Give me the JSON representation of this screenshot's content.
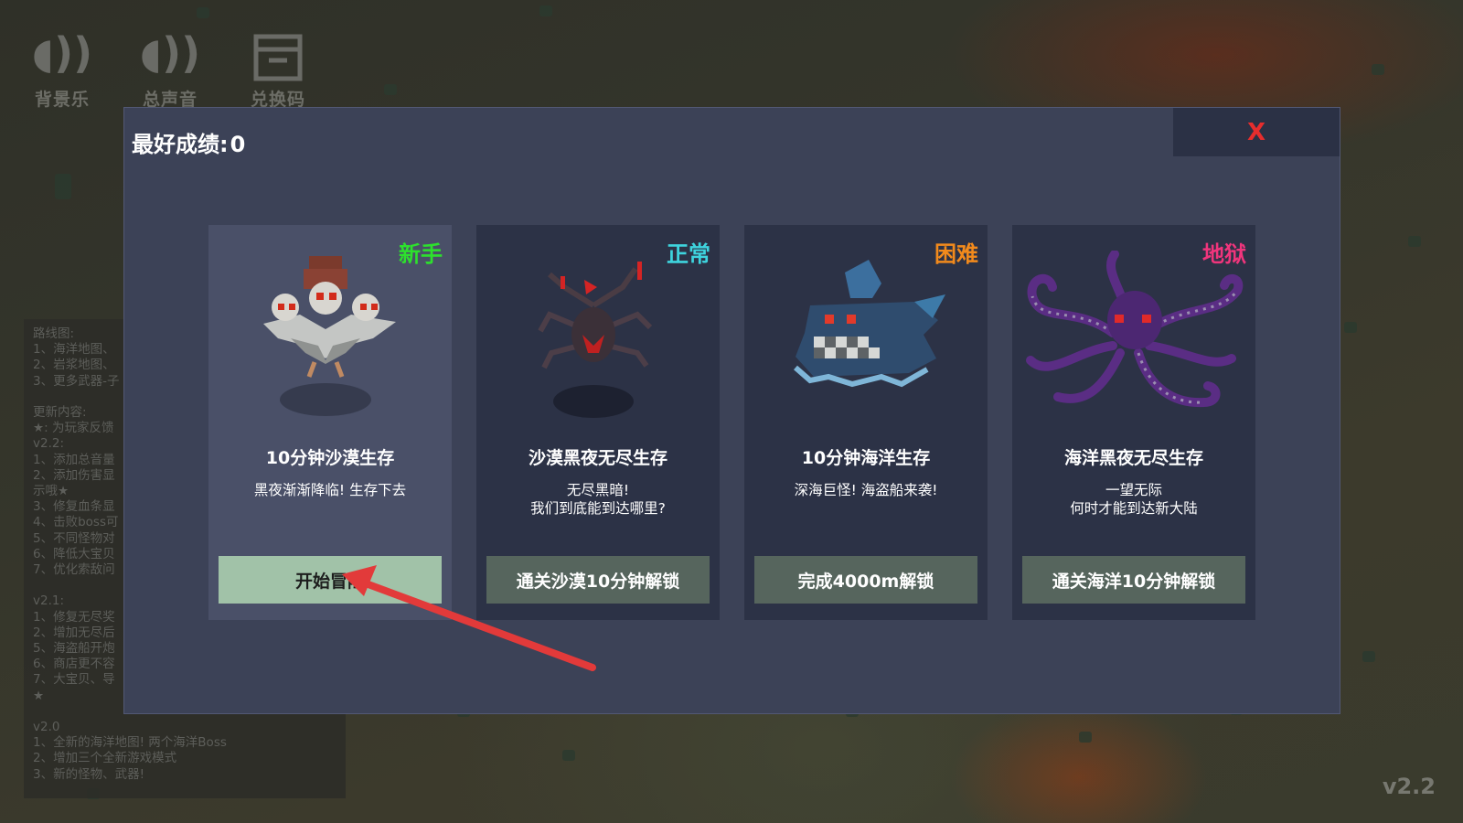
{
  "top_icons": [
    {
      "label": "背景乐",
      "icon": "speaker-icon"
    },
    {
      "label": "总声音",
      "icon": "speaker-icon"
    },
    {
      "label": "兑换码",
      "icon": "gift-box-icon"
    }
  ],
  "changelog": {
    "text": "路线图:\n1、海洋地图、\n2、岩浆地图、\n3、更多武器-子\n\n更新内容:\n★: 为玩家反馈\nv2.2:\n1、添加总音量\n2、添加伤害显\n示哦★\n3、修复血条显\n4、击败boss可\n5、不同怪物对\n6、降低大宝贝\n7、优化索敌问\n\nv2.1:\n1、修复无尽奖\n2、增加无尽后\n5、海盗船开炮\n6、商店更不容\n7、大宝贝、导\n★\n\nv2.0\n1、全新的海洋地图! 两个海洋Boss\n2、增加三个全新游戏模式\n3、新的怪物、武器!"
  },
  "version": "v2.2",
  "modal": {
    "best_label": "最好成绩:",
    "best_value": "0",
    "close_label": "X",
    "close_color": "#e62d2d",
    "cards": [
      {
        "difficulty": "新手",
        "difficulty_color": "#2de12d",
        "creature": "three-headed-vulture",
        "title": "10分钟沙漠生存",
        "desc": [
          "黑夜渐渐降临! 生存下去"
        ],
        "button": "开始冒险",
        "selected": true,
        "unlocked": true
      },
      {
        "difficulty": "正常",
        "difficulty_color": "#3ed4de",
        "creature": "dark-spider-wraith",
        "title": "沙漠黑夜无尽生存",
        "desc": [
          "无尽黑暗!",
          "我们到底能到达哪里?"
        ],
        "button": "通关沙漠10分钟解锁",
        "selected": false,
        "unlocked": false
      },
      {
        "difficulty": "困难",
        "difficulty_color": "#f28a1c",
        "creature": "sea-shark-monster",
        "title": "10分钟海洋生存",
        "desc": [
          "深海巨怪! 海盗船来袭!"
        ],
        "button": "完成4000m解锁",
        "selected": false,
        "unlocked": false
      },
      {
        "difficulty": "地狱",
        "difficulty_color": "#f0357c",
        "creature": "purple-kraken",
        "title": "海洋黑夜无尽生存",
        "desc": [
          "一望无际",
          "何时才能到达新大陆"
        ],
        "button": "通关海洋10分钟解锁",
        "selected": false,
        "unlocked": false
      }
    ]
  },
  "arrow_color": "#e23a3a"
}
